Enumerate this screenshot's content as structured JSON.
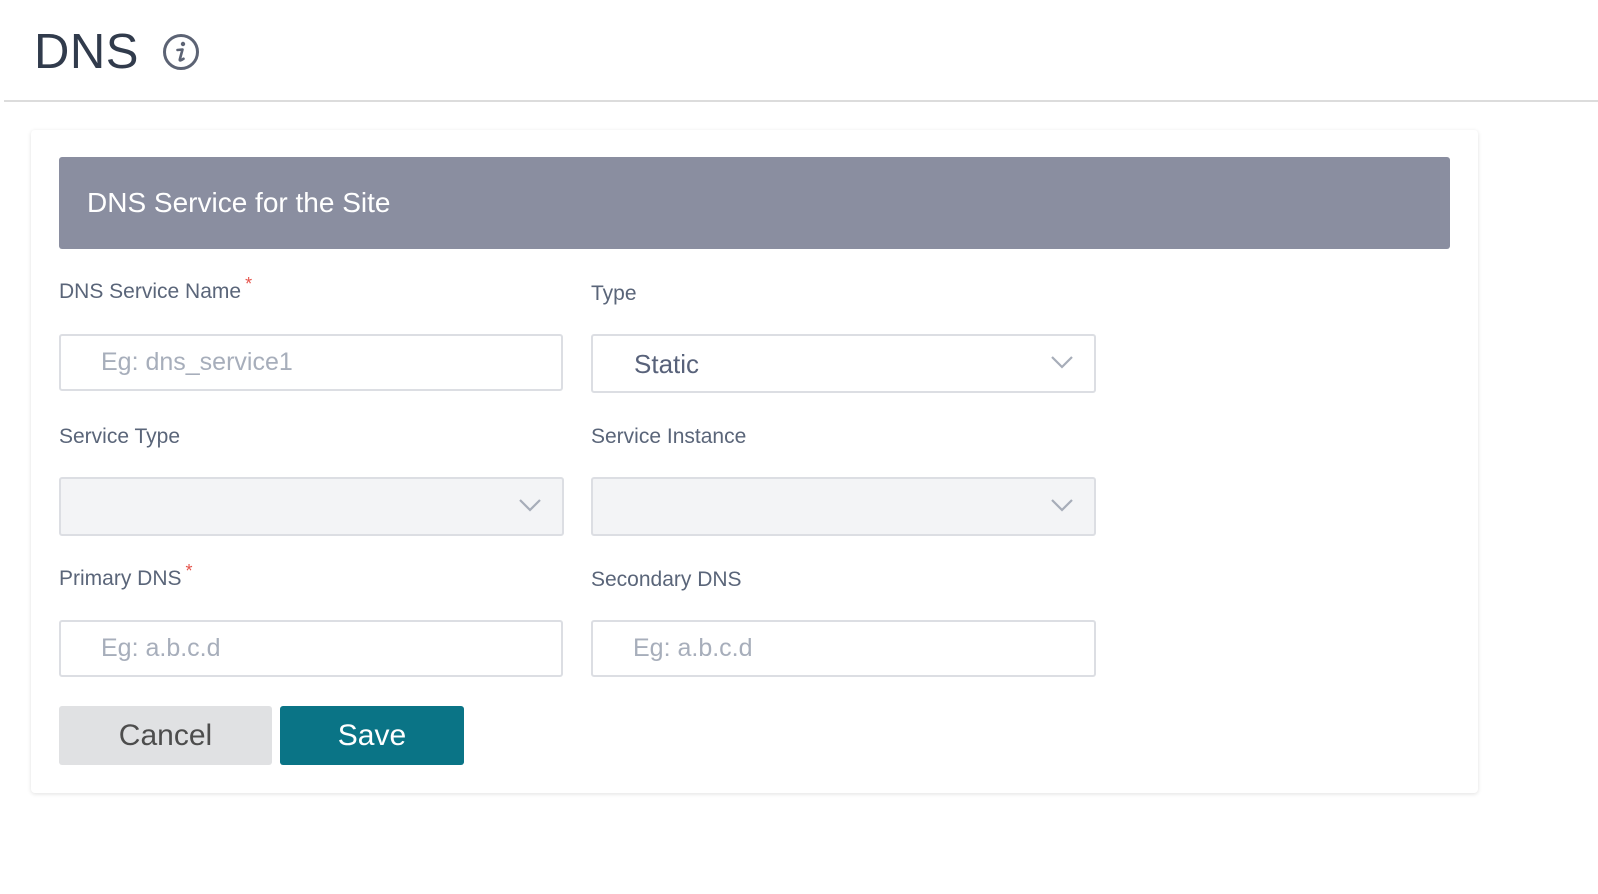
{
  "page": {
    "title": "DNS",
    "info_icon": "info-circle-icon"
  },
  "section": {
    "title": "DNS Service for the Site"
  },
  "form": {
    "dns_service_name": {
      "label": "DNS Service Name",
      "required_mark": "*",
      "value": "",
      "placeholder": "Eg: dns_service1"
    },
    "type": {
      "label": "Type",
      "selected": "Static"
    },
    "service_type": {
      "label": "Service Type",
      "selected": "",
      "disabled": true
    },
    "service_instance": {
      "label": "Service Instance",
      "selected": "",
      "disabled": true
    },
    "primary_dns": {
      "label": "Primary DNS",
      "required_mark": "*",
      "value": "",
      "placeholder": "Eg: a.b.c.d"
    },
    "secondary_dns": {
      "label": "Secondary DNS",
      "value": "",
      "placeholder": "Eg: a.b.c.d"
    }
  },
  "actions": {
    "cancel_label": "Cancel",
    "save_label": "Save"
  },
  "colors": {
    "section_header_bg": "#8a8ea0",
    "primary_button": "#0a7486",
    "secondary_button": "#e0e1e3",
    "required_mark": "#e5534b"
  }
}
